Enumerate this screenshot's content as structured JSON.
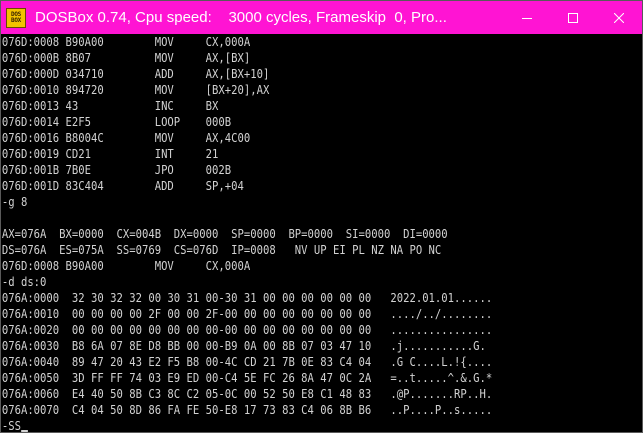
{
  "window": {
    "title": "DOSBox 0.74, Cpu speed:    3000 cycles, Frameskip  0, Pro...",
    "icon_text_top": "DOS",
    "icon_text_bottom": "BOX",
    "icon": "dosbox-icon",
    "buttons": [
      "minimize-icon",
      "maximize-icon",
      "close-icon"
    ]
  },
  "colors": {
    "titlebar": "#ff14d3",
    "console_bg": "#000000",
    "console_text": "#d2d2d2"
  },
  "console": {
    "lines": [
      "076D:0008 B90A00        MOV     CX,000A",
      "076D:000B 8B07          MOV     AX,[BX]",
      "076D:000D 034710        ADD     AX,[BX+10]",
      "076D:0010 894720        MOV     [BX+20],AX",
      "076D:0013 43            INC     BX",
      "076D:0014 E2F5          LOOP    000B",
      "076D:0016 B8004C        MOV     AX,4C00",
      "076D:0019 CD21          INT     21",
      "076D:001B 7B0E          JPO     002B",
      "076D:001D 83C404        ADD     SP,+04",
      "-g 8",
      "",
      "AX=076A  BX=0000  CX=004B  DX=0000  SP=0000  BP=0000  SI=0000  DI=0000",
      "DS=076A  ES=075A  SS=0769  CS=076D  IP=0008   NV UP EI PL NZ NA PO NC",
      "076D:0008 B90A00        MOV     CX,000A",
      "-d ds:0",
      "076A:0000  32 30 32 32 00 30 31 00-30 31 00 00 00 00 00 00   2022.01.01......",
      "076A:0010  00 00 00 00 2F 00 00 2F-00 00 00 00 00 00 00 00   ..../../........",
      "076A:0020  00 00 00 00 00 00 00 00-00 00 00 00 00 00 00 00   ................",
      "076A:0030  B8 6A 07 8E D8 BB 00 00-B9 0A 00 8B 07 03 47 10   .j...........G.",
      "076A:0040  89 47 20 43 E2 F5 B8 00-4C CD 21 7B 0E 83 C4 04   .G C....L.!{....",
      "076A:0050  3D FF FF 74 03 E9 ED 00-C4 5E FC 26 8A 47 0C 2A   =..t.....^.&.G.*",
      "076A:0060  E4 40 50 8B C3 8C C2 05-0C 00 52 50 E8 C1 48 83   .@P.......RP..H.",
      "076A:0070  C4 04 50 8D 86 FA FE 50-E8 17 73 83 C4 06 8B B6   ..P....P..s.....",
      "-SS"
    ]
  }
}
